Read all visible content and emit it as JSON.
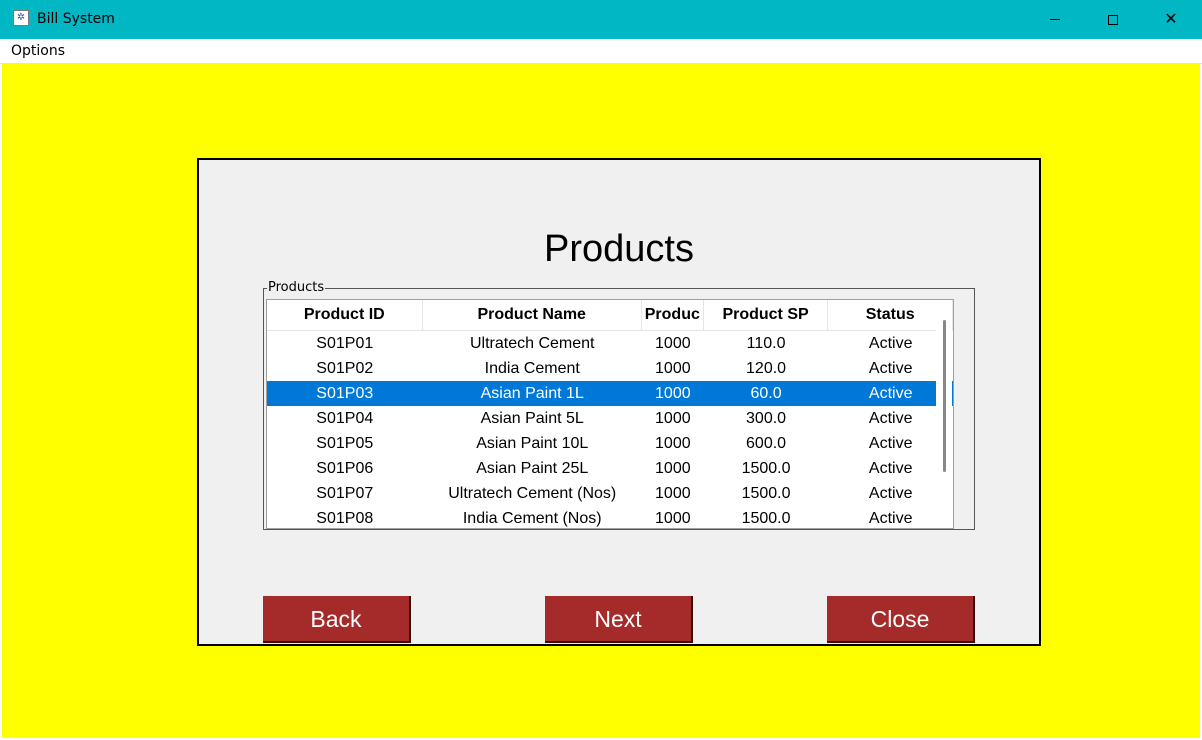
{
  "window": {
    "title": "Bill System",
    "controls": {
      "minimize": "",
      "maximize": "",
      "close": "✕"
    }
  },
  "menu": {
    "options_label": "Options"
  },
  "page": {
    "title": "Products"
  },
  "table": {
    "group_label": "Products",
    "columns": [
      "Product ID",
      "Product Name",
      "Produc",
      "Product SP",
      "Status"
    ],
    "rows": [
      {
        "id": "S01P01",
        "name": "Ultratech Cement",
        "qty": "1000",
        "sp": "110.0",
        "status": "Active"
      },
      {
        "id": "S01P02",
        "name": "India Cement",
        "qty": "1000",
        "sp": "120.0",
        "status": "Active"
      },
      {
        "id": "S01P03",
        "name": "Asian Paint 1L",
        "qty": "1000",
        "sp": "60.0",
        "status": "Active"
      },
      {
        "id": "S01P04",
        "name": "Asian Paint 5L",
        "qty": "1000",
        "sp": "300.0",
        "status": "Active"
      },
      {
        "id": "S01P05",
        "name": "Asian Paint 10L",
        "qty": "1000",
        "sp": "600.0",
        "status": "Active"
      },
      {
        "id": "S01P06",
        "name": "Asian Paint 25L",
        "qty": "1000",
        "sp": "1500.0",
        "status": "Active"
      },
      {
        "id": "S01P07",
        "name": "Ultratech Cement (Nos)",
        "qty": "1000",
        "sp": "1500.0",
        "status": "Active"
      },
      {
        "id": "S01P08",
        "name": "India Cement (Nos)",
        "qty": "1000",
        "sp": "1500.0",
        "status": "Active"
      }
    ],
    "selected_row_id": "S01P03"
  },
  "buttons": {
    "back": "Back",
    "next": "Next",
    "close": "Close"
  },
  "colors": {
    "titlebar": "#00b7c3",
    "background": "#ffff00",
    "panel": "#f0f0f0",
    "button": "#a52a2a",
    "selection": "#0078d7"
  }
}
